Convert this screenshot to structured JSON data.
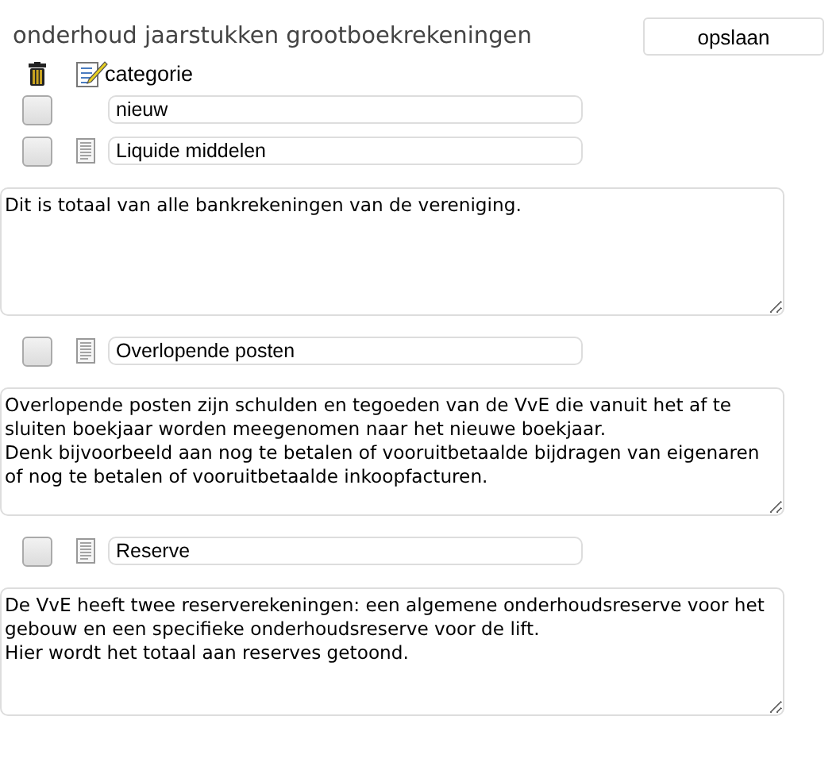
{
  "title": "onderhoud jaarstukken grootboekrekeningen",
  "save_button": "opslaan",
  "header": {
    "label": "categorie"
  },
  "rows": [
    {
      "kind": "new",
      "checked": false,
      "name": "nieuw"
    },
    {
      "kind": "account",
      "checked": false,
      "name": "Liquide middelen",
      "description": "Dit is totaal van alle bankrekeningen van de vereniging."
    },
    {
      "kind": "account",
      "checked": false,
      "name": "Overlopende posten",
      "description": "Overlopende posten zijn schulden en tegoeden van de VvE die vanuit het af te sluiten boekjaar worden meegenomen naar het nieuwe boekjaar.\nDenk bijvoorbeeld aan nog te betalen of vooruitbetaalde bijdragen van eigenaren of nog te betalen of vooruitbetaalde inkoopfacturen."
    },
    {
      "kind": "account",
      "checked": false,
      "name": "Reserve",
      "description": "De VvE heeft twee reserverekeningen: een algemene onderhoudsreserve voor het gebouw en een specifieke onderhoudsreserve voor de lift.\nHier wordt het totaal aan reserves getoond."
    }
  ]
}
